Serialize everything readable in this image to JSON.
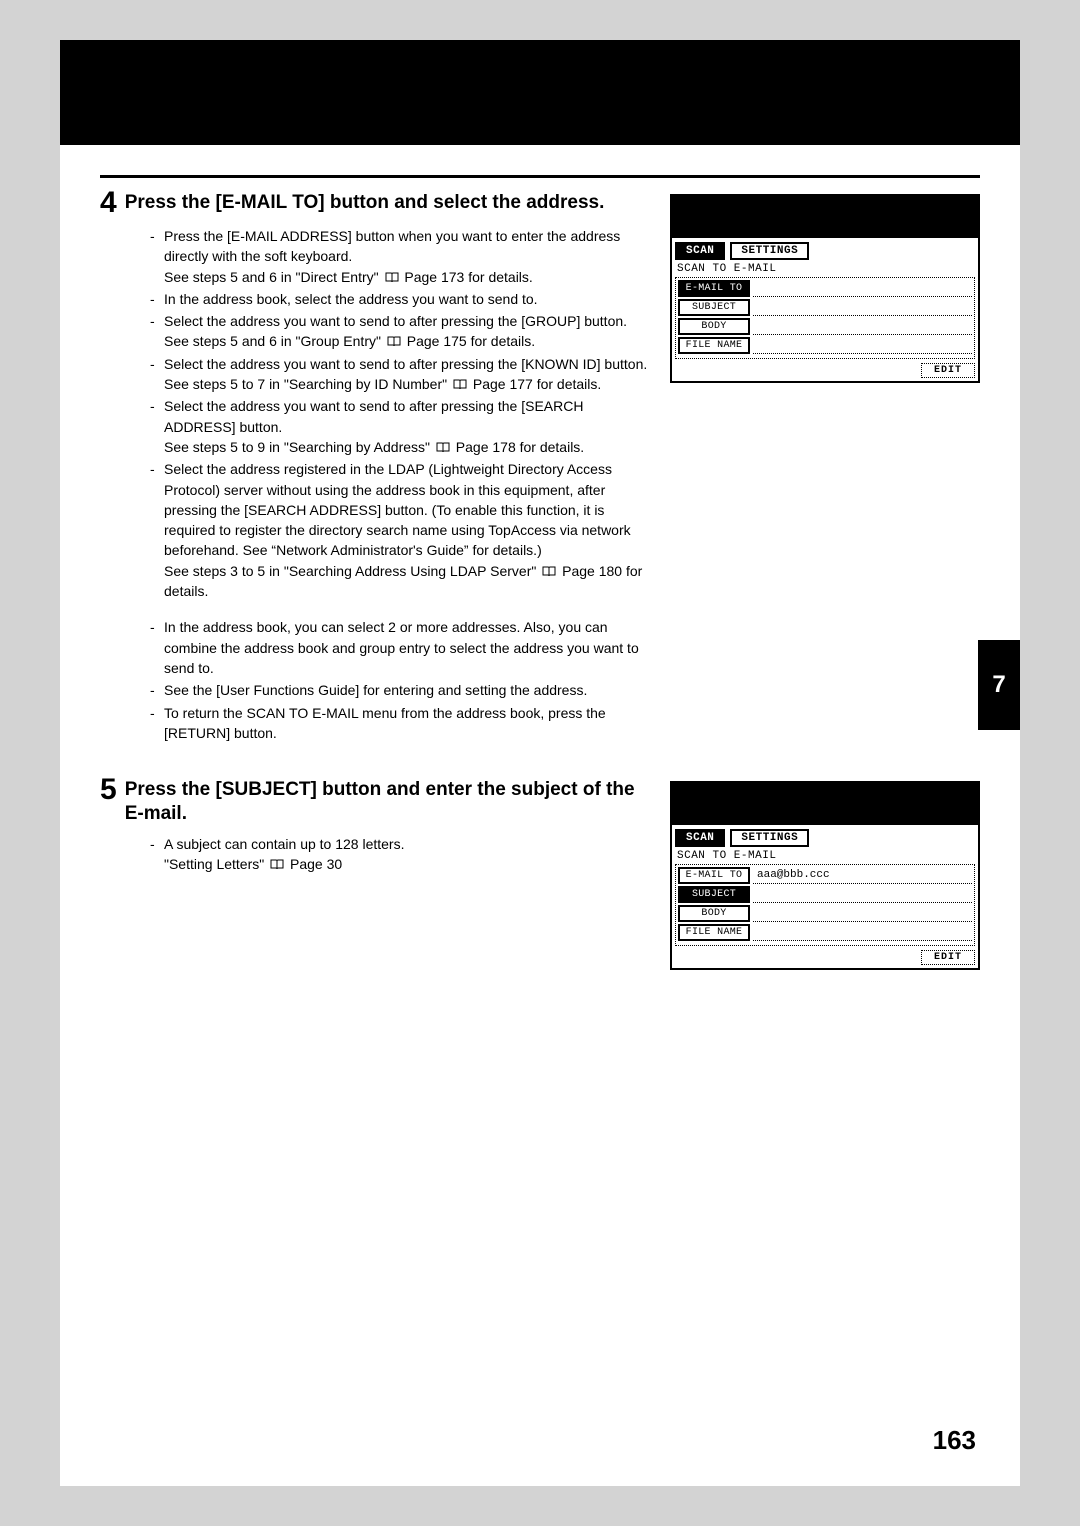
{
  "page_number": "163",
  "thumb_tab": "7",
  "step4": {
    "num": "4",
    "title": "Press the [E-MAIL TO] button and select the address.",
    "bullets": [
      "Press the [E-MAIL ADDRESS] button when you want to enter the address directly with the soft keyboard.\nSee steps 5 and 6 in \"Direct Entry\" 📖 Page 173 for details.",
      "In the address book, select the address you want to send to.",
      "Select the address you want to send to after pressing the [GROUP] button.\nSee steps 5 and 6 in \"Group Entry\" 📖 Page 175 for details.",
      "Select the address you want to send to after pressing the [KNOWN ID] button.\nSee steps 5 to 7 in \"Searching by ID Number\" 📖 Page 177 for details.",
      "Select the address you want to send to after pressing the [SEARCH ADDRESS] button.\nSee steps 5 to 9 in \"Searching by Address\" 📖 Page 178 for details.",
      "Select the address registered in the LDAP (Lightweight Directory Access Protocol) server without using the address book in this equipment, after pressing the [SEARCH ADDRESS] button. (To enable this function, it is required to register the directory search name using TopAccess via network beforehand. See “Network Administrator's Guide” for details.)\nSee steps 3 to 5 in \"Searching Address Using LDAP Server\" 📖 Page 180 for details.",
      "In the address book, you can select 2 or more addresses. Also, you can combine the address book and group entry to select the address you want to send to.",
      "See the [User Functions Guide] for entering and setting the address.",
      "To return the SCAN TO E-MAIL menu from the address book, press the [RETURN] button."
    ]
  },
  "step5": {
    "num": "5",
    "title": "Press the [SUBJECT] button and enter the subject of the E-mail.",
    "bullets": [
      "A subject can contain up to 128 letters.\n\"Setting Letters\" 📖 Page 30"
    ]
  },
  "panel": {
    "tab_scan": "SCAN",
    "tab_settings": "SETTINGS",
    "title": "SCAN TO E-MAIL",
    "btn_email": "E-MAIL TO",
    "btn_subject": "SUBJECT",
    "btn_body": "BODY",
    "btn_filename": "FILE NAME",
    "edit": "EDIT",
    "email_value": "aaa@bbb.ccc"
  }
}
